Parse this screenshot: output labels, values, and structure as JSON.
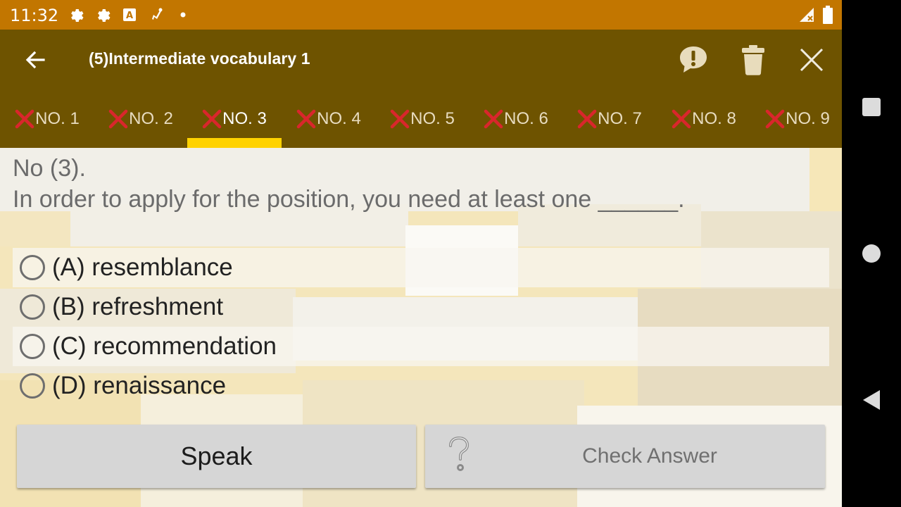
{
  "status_bar": {
    "time": "11:32",
    "left_icons": [
      "settings-icon",
      "settings-icon",
      "keyboard-a-icon",
      "sync-icon",
      "dot-icon"
    ],
    "right_icons": [
      "signal-icon",
      "battery-icon"
    ]
  },
  "app_bar": {
    "title": "(5)Intermediate vocabulary 1",
    "actions": [
      "report-icon",
      "trash-icon",
      "close-icon"
    ]
  },
  "tabs": [
    {
      "label": "NO. 1",
      "status": "wrong"
    },
    {
      "label": "NO. 2",
      "status": "wrong"
    },
    {
      "label": "NO. 3",
      "status": "wrong",
      "active": true
    },
    {
      "label": "NO. 4",
      "status": "wrong"
    },
    {
      "label": "NO. 5",
      "status": "wrong"
    },
    {
      "label": "NO. 6",
      "status": "wrong"
    },
    {
      "label": "NO. 7",
      "status": "wrong"
    },
    {
      "label": "NO. 8",
      "status": "wrong"
    },
    {
      "label": "NO. 9",
      "status": "wrong"
    }
  ],
  "question": {
    "number": "No (3).",
    "text": "In order to apply for the position, you need at least one ______."
  },
  "options": [
    {
      "label": "(A) resemblance",
      "selected": false
    },
    {
      "label": "(B) refreshment",
      "selected": false
    },
    {
      "label": "(C) recommendation",
      "selected": false
    },
    {
      "label": "(D) renaissance",
      "selected": false
    }
  ],
  "buttons": {
    "speak": "Speak",
    "check_answer": "Check Answer"
  },
  "colors": {
    "status_bar": "#c27600",
    "app_bar": "#6e5300",
    "tab_indicator": "#ffd200",
    "wrong_mark": "#d9262c"
  }
}
